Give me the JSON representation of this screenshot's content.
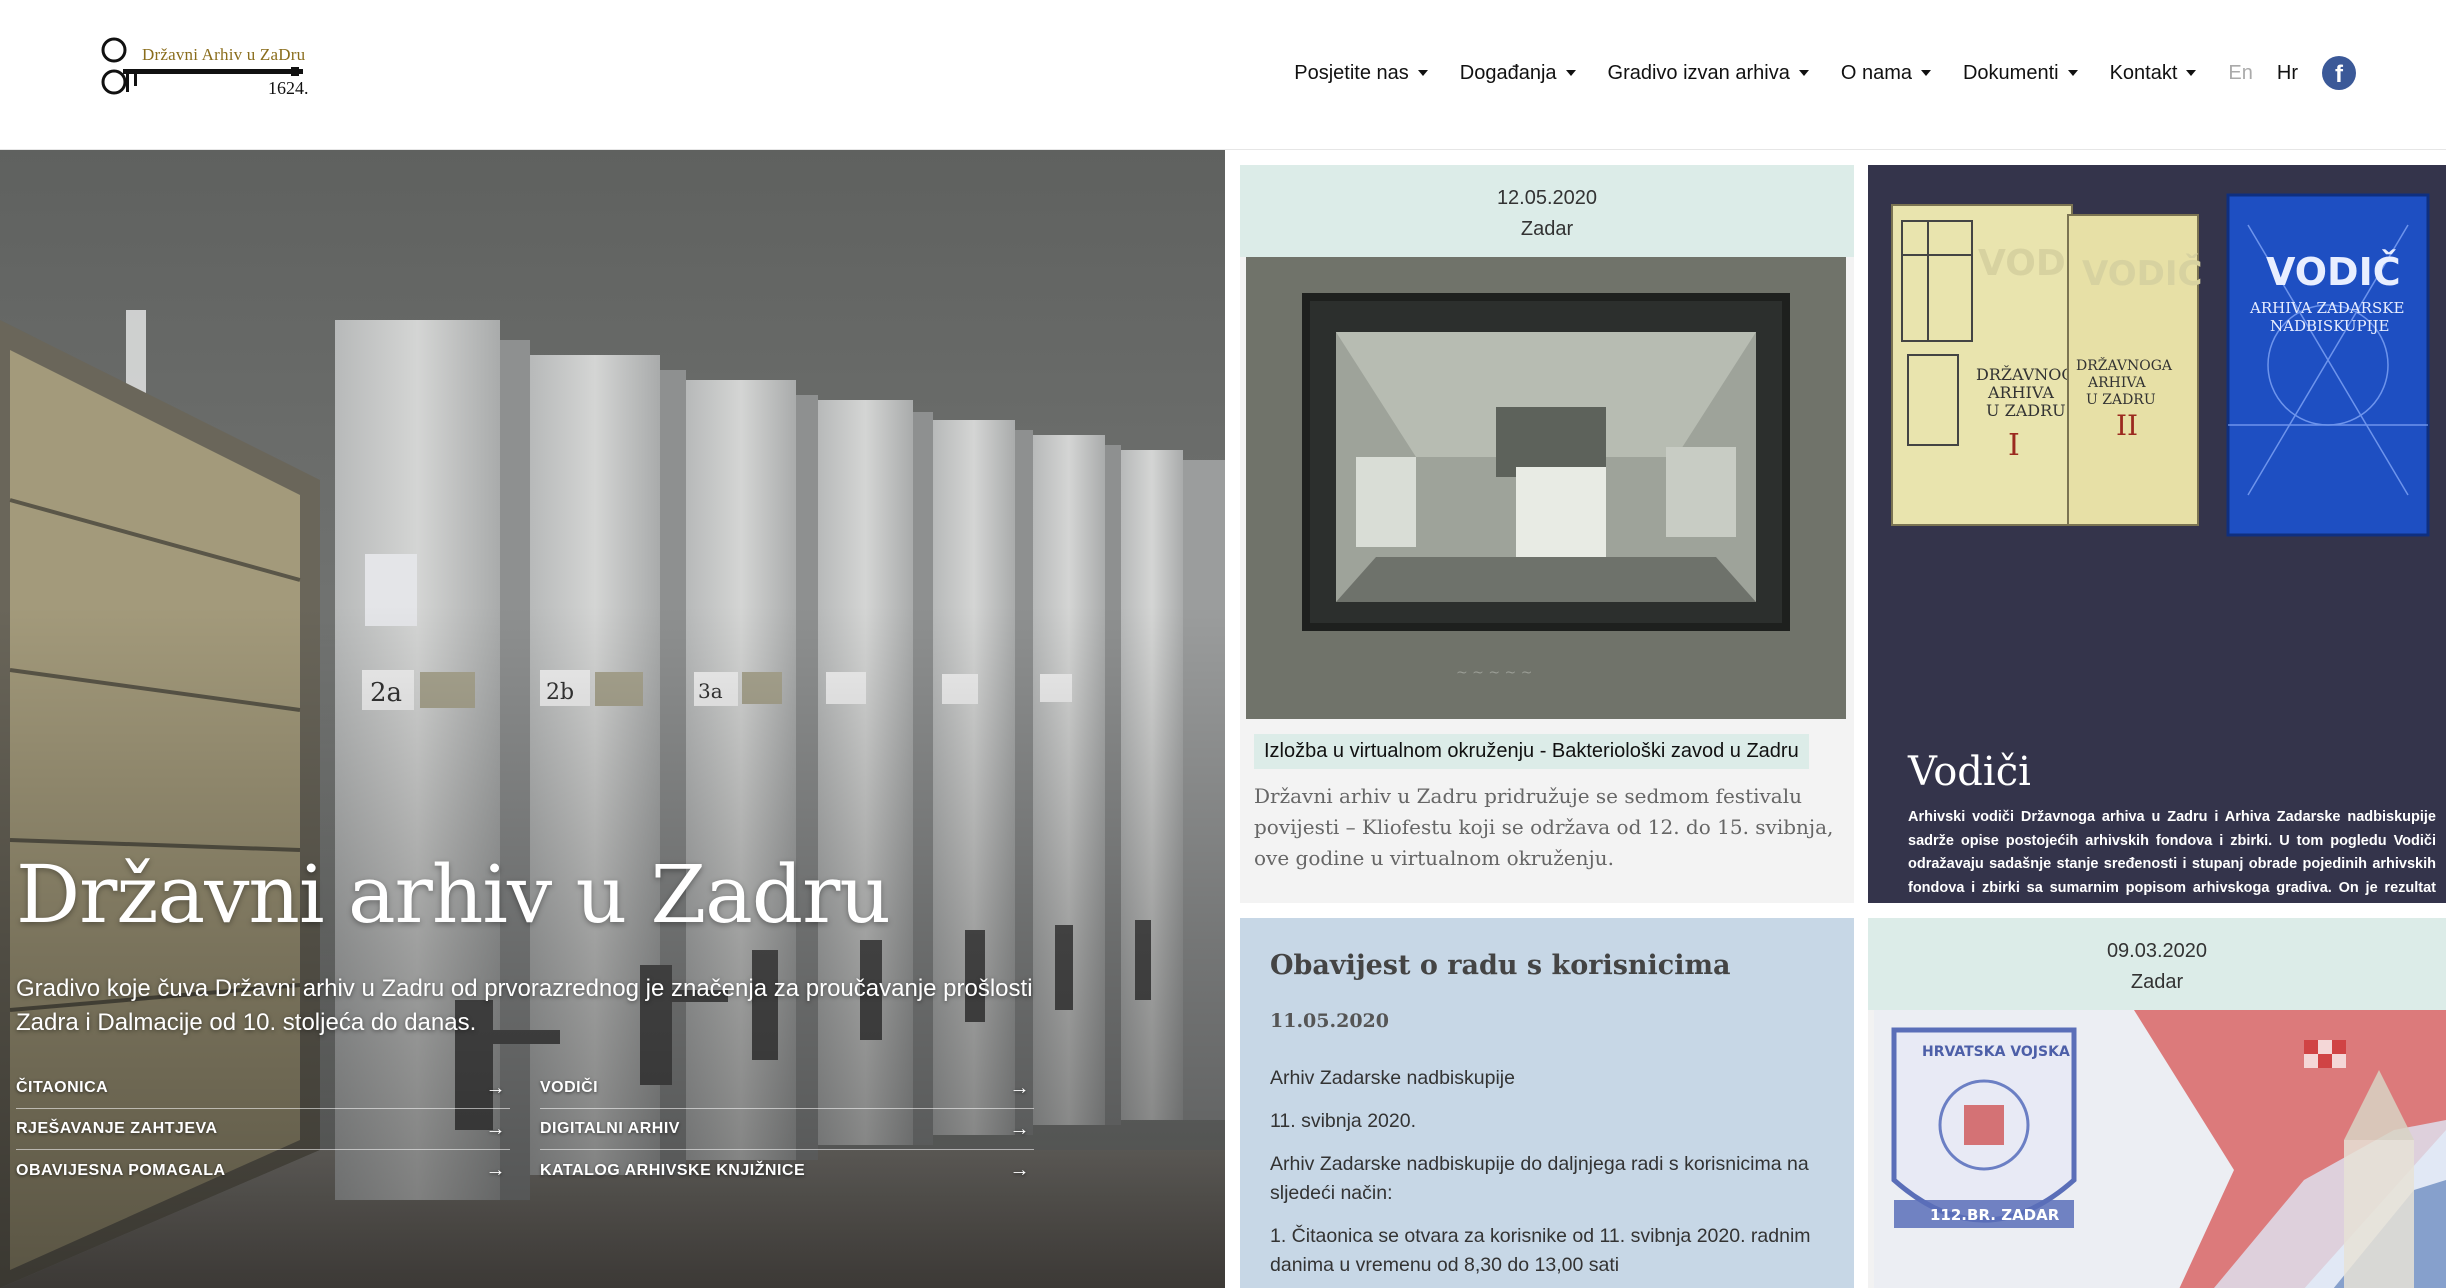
{
  "header": {
    "logo": {
      "text": "Državni Arhiv u ZaDru",
      "year": "1624."
    },
    "nav": [
      {
        "label": "Posjetite nas"
      },
      {
        "label": "Događanja"
      },
      {
        "label": "Gradivo izvan arhiva"
      },
      {
        "label": "O nama"
      },
      {
        "label": "Dokumenti"
      },
      {
        "label": "Kontakt"
      }
    ],
    "lang": {
      "en": "En",
      "hr": "Hr"
    },
    "facebook_icon": "facebook-icon"
  },
  "hero": {
    "title": "Državni arhiv u Zadru",
    "subtitle": "Gradivo koje čuva Državni arhiv u Zadru od prvorazrednog je značenja za proučavanje prošlosti Zadra i Dalmacije od 10. stoljeća do danas.",
    "links_left": [
      "ČITAONICA",
      "RJEŠAVANJE ZAHTJEVA",
      "OBAVIJESNA POMAGALA"
    ],
    "links_right": [
      "VODIČI",
      "DIGITALNI ARHIV",
      "KATALOG ARHIVSKE KNJIŽNICE"
    ],
    "shelf_labels": [
      "2a",
      "2b",
      "3a"
    ]
  },
  "cards": {
    "event1": {
      "date": "12.05.2020",
      "place": "Zadar",
      "tag": "Izložba u virtualnom okruženju - Bakteriološki zavod u Zadru",
      "excerpt": "Državni arhiv u Zadru pridružuje se sedmom festivalu povijesti – Kliofestu koji se održava od 12. do 15. svibnja, ove godine u virtualnom okruženju."
    },
    "guides": {
      "title": "Vodiči",
      "description": "Arhivski vodiči Državnoga arhiva u Zadru i Arhiva Zadarske nadbiskupije sadrže opise postojećih arhivskih fondova i zbirki. U tom pogledu Vodiči odražavaju sadašnje stanje sređenosti i stupanj obrade pojedinih arhivskih fondova i zbirki sa sumarnim popisom arhivskoga gradiva. On je rezultat rada arhivskih ustanova od osnivanja, pa do trenutka kada se objavljuju njihovi arhivski vodiči. Vodiči na najvišoj razini pružaju bitne informacije o arhivskim fondovima i zbirkama.",
      "books": [
        {
          "title": "VODIČ",
          "lines": [
            "DRŽAVNOGA",
            "ARHIVA",
            "U ZADRU"
          ],
          "volume": "I"
        },
        {
          "title": "VODIČ",
          "lines": [
            "DRŽAVNOGA",
            "ARHIVA",
            "U ZADRU"
          ],
          "volume": "II"
        },
        {
          "title": "VODIČ",
          "lines": [
            "ARHIVA ZADARSKE",
            "NADBISKUPIJE"
          ],
          "volume": ""
        }
      ]
    },
    "notice": {
      "title": "Obavijest o radu s korisnicima",
      "date": "11.05.2020",
      "paragraphs": [
        "Arhiv Zadarske nadbiskupije",
        "11. svibnja 2020.",
        "Arhiv Zadarske nadbiskupije do daljnjega radi s korisnicima na sljedeći način:",
        "1. Čitaonica se otvara za korisnike od 11. svibnja 2020. radnim danima u vremenu od 8,30 do 13,00 sati"
      ]
    },
    "event2": {
      "date": "09.03.2020",
      "place": "Zadar",
      "badge": {
        "top": "HRVATSKA VOJSKA",
        "bottom": "112.BR. ZADAR"
      }
    }
  },
  "colors": {
    "date_bar": "#dcece8",
    "guides_bg": "#34344b",
    "notice_bg": "#c7d7e6",
    "facebook": "#3b5998"
  }
}
